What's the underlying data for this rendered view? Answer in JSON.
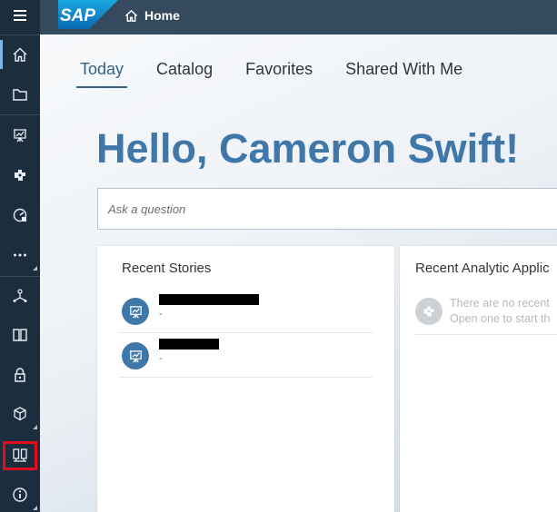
{
  "shell": {
    "logo_text": "SAP",
    "breadcrumb": "Home"
  },
  "sidebar": {
    "items": [
      {
        "icon": "menu-icon"
      },
      {
        "icon": "home-icon",
        "active": true
      },
      {
        "icon": "folder-icon"
      },
      {
        "icon": "story-icon"
      },
      {
        "icon": "analytic-app-icon"
      },
      {
        "icon": "performance-icon"
      },
      {
        "icon": "more-icon"
      },
      {
        "icon": "data-model-icon"
      },
      {
        "icon": "book-icon"
      },
      {
        "icon": "security-icon"
      },
      {
        "icon": "deployment-icon"
      },
      {
        "icon": "connections-icon",
        "highlighted": true
      },
      {
        "icon": "info-icon"
      }
    ]
  },
  "tabs": [
    {
      "label": "Today",
      "selected": true
    },
    {
      "label": "Catalog"
    },
    {
      "label": "Favorites"
    },
    {
      "label": "Shared With Me"
    }
  ],
  "greeting": "Hello, Cameron Swift!",
  "search": {
    "placeholder": "Ask a question"
  },
  "recent_stories": {
    "title": "Recent Stories",
    "items": [
      {
        "subtitle": "-",
        "redacted": true
      },
      {
        "subtitle": "-",
        "redacted": true
      }
    ]
  },
  "recent_apps": {
    "title": "Recent Analytic Applic",
    "empty_line1": "There are no recent",
    "empty_line2": "Open one to start th"
  },
  "colors": {
    "sidebar": "#1c2d3e",
    "shellbar": "#354a5f",
    "accent": "#3f78a8",
    "highlight": "#e00c1f"
  }
}
